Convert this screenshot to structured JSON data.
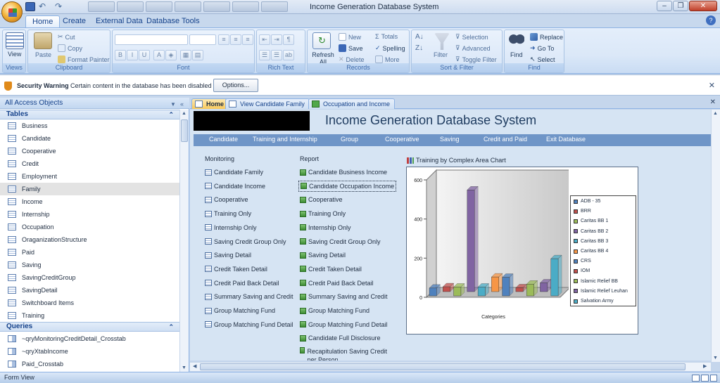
{
  "window": {
    "title": "Income Generation Database System"
  },
  "ribbon_tabs": [
    "Home",
    "Create",
    "External Data",
    "Database Tools"
  ],
  "ribbon": {
    "views": {
      "view": "View",
      "group": "Views"
    },
    "clipboard": {
      "paste": "Paste",
      "cut": "Cut",
      "copy": "Copy",
      "format_painter": "Format Painter",
      "group": "Clipboard"
    },
    "font": {
      "group": "Font"
    },
    "rich_text": {
      "group": "Rich Text"
    },
    "records": {
      "refresh": "Refresh All",
      "new": "New",
      "save": "Save",
      "delete": "Delete",
      "totals": "Totals",
      "spelling": "Spelling",
      "more": "More",
      "group": "Records"
    },
    "sort_filter": {
      "filter": "Filter",
      "selection": "Selection",
      "advanced": "Advanced",
      "toggle_filter": "Toggle Filter",
      "group": "Sort & Filter"
    },
    "find": {
      "find": "Find",
      "replace": "Replace",
      "goto": "Go To",
      "select": "Select",
      "group": "Find"
    }
  },
  "security": {
    "title": "Security Warning",
    "message": "Certain content in the database has been disabled",
    "options": "Options..."
  },
  "nav_pane": {
    "header": "All Access Objects",
    "tables_title": "Tables",
    "tables": [
      "Business",
      "Candidate",
      "Cooperative",
      "Credit",
      "Employment",
      "Family",
      "Income",
      "Internship",
      "Occupation",
      "OraganizationStructure",
      "Paid",
      "Saving",
      "SavingCreditGroup",
      "SavingDetail",
      "Switchboard Items",
      "Training"
    ],
    "selected_table": "Family",
    "queries_title": "Queries",
    "queries": [
      "~qryMonitoringCreditDetail_Crosstab",
      "~qryXtabIncome",
      "Paid_Crosstab"
    ]
  },
  "doc_tabs": [
    "Home",
    "View Candidate Family",
    "Occupation and Income"
  ],
  "form": {
    "title": "Income Generation Database System",
    "menu": [
      "Candidate",
      "Training and Internship",
      "Group",
      "Cooperative",
      "Saving",
      "Credit and Paid",
      "Exit Database"
    ],
    "monitoring_title": "Monitoring",
    "monitoring": [
      "Candidate Family",
      "Candidate Income",
      "Cooperative",
      "Training Only",
      "Internship Only",
      "Saving Credit Group Only",
      "Saving Detail",
      "Credit Taken Detail",
      "Credit Paid Back Detail",
      "Summary Saving and Credit",
      "Group Matching Fund",
      "Group Matching Fund Detail"
    ],
    "report_title": "Report",
    "report": [
      "Candidate Business Income",
      "Candidate Occupation Income",
      "Cooperative",
      "Training Only",
      "Internship Only",
      "Saving Credit Group Only",
      "Saving Detail",
      "Credit Taken Detail",
      "Credit Paid Back Detail",
      "Summary Saving and Credit",
      "Group Matching Fund",
      "Group Matching Fund Detail",
      "Candidate Full Disclosure",
      "Recapitulation Saving Credit per Person"
    ],
    "chart_title": "Training by Complex Area Chart"
  },
  "chart_data": {
    "type": "bar",
    "title": "Training by Complex Area Chart",
    "xlabel": "Categories",
    "ylabel": "",
    "ylim": [
      0,
      600
    ],
    "yticks": [
      0,
      200,
      400,
      600
    ],
    "series": [
      {
        "name": "ADB - 35",
        "value": 40,
        "color": "#4f81bd"
      },
      {
        "name": "BRR",
        "value": 25,
        "color": "#c0504d"
      },
      {
        "name": "Caritas BB 1",
        "value": 45,
        "color": "#9bbb59"
      },
      {
        "name": "Caritas BB 2",
        "value": 520,
        "color": "#8064a2"
      },
      {
        "name": "Caritas BB 3",
        "value": 45,
        "color": "#4bacc6"
      },
      {
        "name": "Caritas BB 4",
        "value": 75,
        "color": "#f79646"
      },
      {
        "name": "CRS",
        "value": 95,
        "color": "#4f81bd"
      },
      {
        "name": "IOM",
        "value": 20,
        "color": "#c0504d"
      },
      {
        "name": "Islamic Relief BB",
        "value": 60,
        "color": "#9bbb59"
      },
      {
        "name": "Islamic Relief Leuhan",
        "value": 45,
        "color": "#8064a2"
      },
      {
        "name": "Salvation Army",
        "value": 190,
        "color": "#4bacc6"
      }
    ]
  },
  "status": {
    "text": "Form View"
  }
}
